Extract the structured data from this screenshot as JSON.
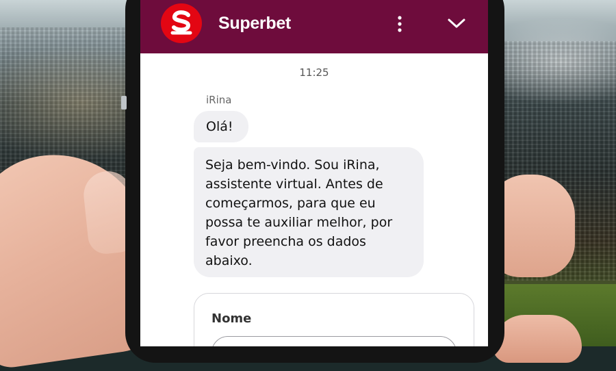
{
  "header": {
    "brand": "Superbet",
    "logo_letter": "S",
    "menu_icon": "more-vertical-icon",
    "collapse_icon": "chevron-down-icon"
  },
  "chat": {
    "timestamp": "11:25",
    "sender": "iRina",
    "messages": [
      {
        "text": "Olá!"
      },
      {
        "lines": [
          "Seja bem-vindo. Sou iRina,",
          "assistente virtual. Antes de",
          "começarmos, para que eu",
          "possa te auxiliar melhor, por",
          "favor preencha os dados",
          "abaixo."
        ]
      }
    ]
  },
  "form": {
    "name_label": "Nome",
    "name_value": ""
  },
  "colors": {
    "header_bg": "#6e0c3c",
    "logo_red": "#e30613",
    "bubble_bg": "#f0f0f3"
  }
}
